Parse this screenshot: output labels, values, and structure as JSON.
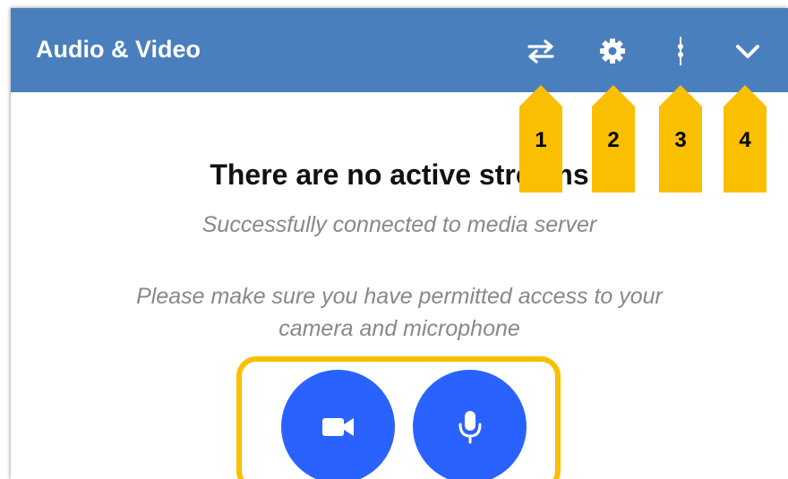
{
  "header": {
    "title": "Audio & Video",
    "buttons": [
      {
        "icon": "swap-arrows-icon"
      },
      {
        "icon": "gear-icon"
      },
      {
        "icon": "vertical-dots-icon"
      },
      {
        "icon": "chevron-down-icon"
      }
    ]
  },
  "callouts": [
    "1",
    "2",
    "3",
    "4"
  ],
  "content": {
    "empty_title": "There are no active streams",
    "status": "Successfully connected to media server",
    "permission_line1": "Please make sure you have permitted access to your",
    "permission_line2": "camera and microphone"
  },
  "media_buttons": {
    "camera_icon": "video-camera-icon",
    "mic_icon": "microphone-icon"
  },
  "colors": {
    "header": "#4a7fbd",
    "callout": "#f9bf00",
    "button": "#2962ff",
    "muted_text": "#888888"
  }
}
